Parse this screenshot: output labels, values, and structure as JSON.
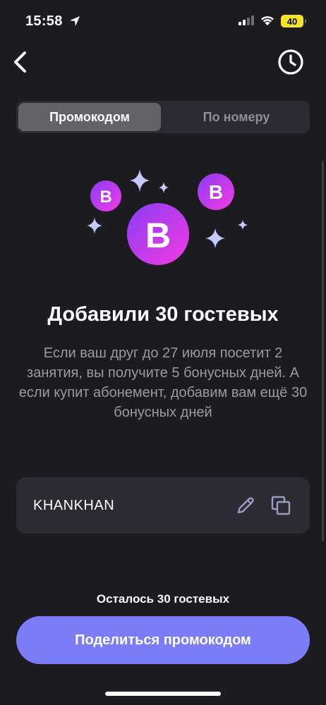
{
  "status_bar": {
    "time": "15:58",
    "battery": "40",
    "icons": [
      "location-arrow-icon",
      "signal-icon",
      "wifi-icon",
      "battery-icon"
    ]
  },
  "nav": {
    "back_icon": "chevron-left-icon",
    "history_icon": "clock-icon"
  },
  "tabs": [
    {
      "label": "Промокодом",
      "active": true
    },
    {
      "label": "По номеру",
      "active": false
    }
  ],
  "illustration": {
    "badge_letter": "B",
    "icons": [
      "sparkle-icon",
      "b-coin-icon"
    ]
  },
  "title": "Добавили 30 гостевых",
  "description": "Если ваш друг до 27 июля посетит 2 занятия, вы получите 5 бонусных дней. А если купит абонемент, добавим вам ещё 30 бонусных дней",
  "promo": {
    "code": "KHANKHAN",
    "edit_icon": "pencil-icon",
    "copy_icon": "copy-icon"
  },
  "remaining_text": "Осталось 30 гостевых",
  "share_button": "Поделиться промокодом",
  "colors": {
    "background": "#1c1b1f",
    "card": "#2c2b31",
    "accent": "#7b7cf8",
    "coin_gradient_start": "#8b3cf7",
    "coin_gradient_end": "#f23ce0"
  }
}
